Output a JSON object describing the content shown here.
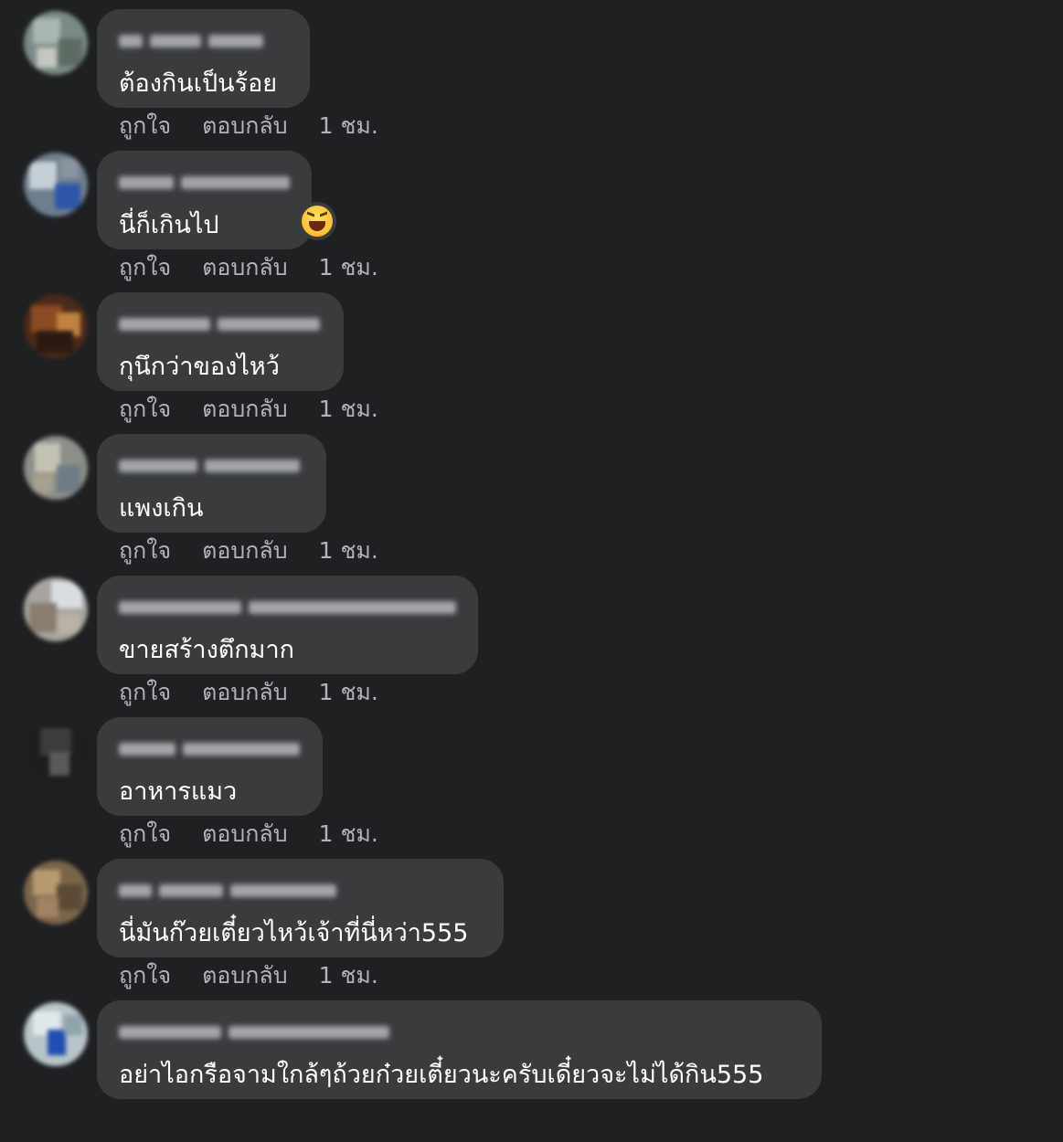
{
  "labels": {
    "like": "ถูกใจ",
    "reply": "ตอบกลับ"
  },
  "comments": [
    {
      "author": "",
      "text": "ต้องกินเป็นร้อย",
      "time": "1 ชม."
    },
    {
      "author": "",
      "text": "นี่ก็เกินไป",
      "time": "1 ชม.",
      "reaction": "haha-icon"
    },
    {
      "author": "",
      "text": "กุนึกว่าของไหว้",
      "time": "1 ชม."
    },
    {
      "author": "",
      "text": "แพงเกิน",
      "time": "1 ชม."
    },
    {
      "author": "",
      "text": "ขายสร้างตึกมาก",
      "time": "1 ชม."
    },
    {
      "author": "",
      "text": "อาหารแมว",
      "time": "1 ชม."
    },
    {
      "author": "",
      "text": "นี่มันก๊วยเตี๋ยวไหว้เจ้าที่นี่หว่า555",
      "time": "1 ชม."
    },
    {
      "author": "",
      "text": "อย่าไอกรือจามใกล้ๆถ้วยก๋วยเตี๋ยวนะครับเดี๋ยวจะไม่ได้กิน555",
      "time": ""
    }
  ],
  "colors": {
    "background": "#1f2022",
    "bubble": "#3a3b3d",
    "text": "#ffffff",
    "secondary_text": "#b0b3b8"
  }
}
